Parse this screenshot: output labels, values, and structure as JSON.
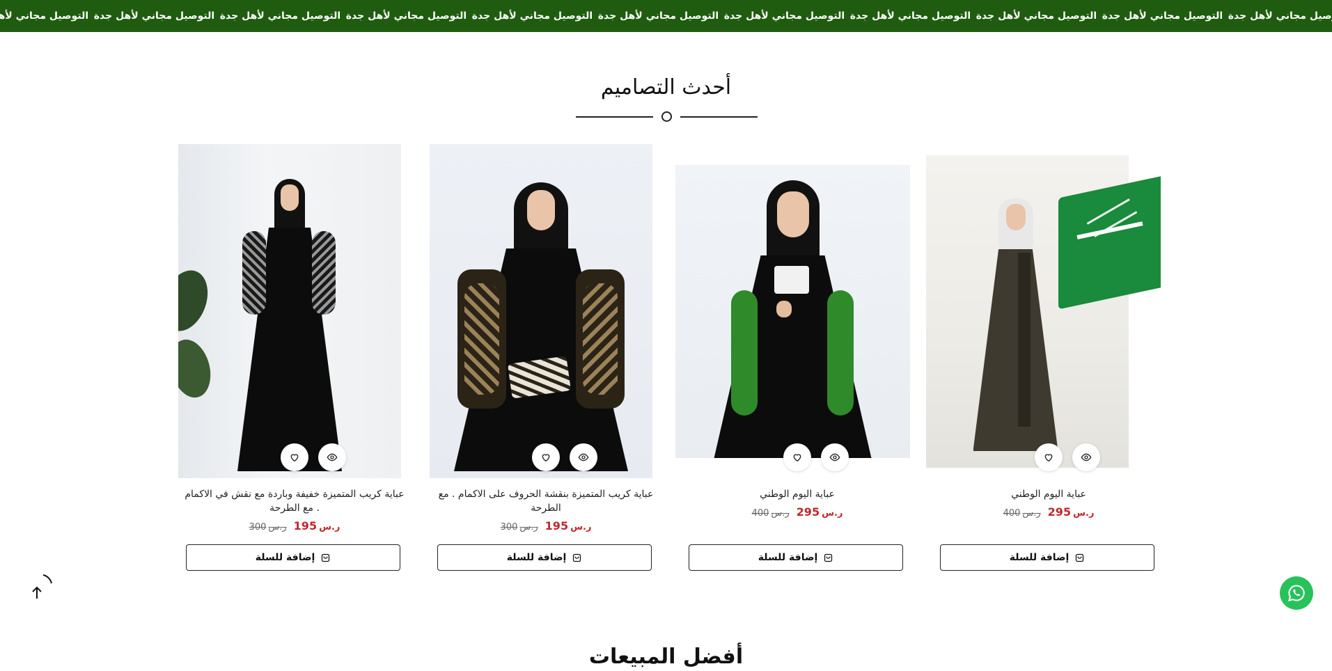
{
  "marquee": {
    "text": "التوصيل مجاني لأهل جدة",
    "items": [
      "التوصيل مجاني لأهل جدة",
      "التوصيل مجاني لأهل جدة",
      "التوصيل مجاني لأهل جدة",
      "التوصيل مجاني لأهل جدة",
      "التوصيل مجاني لأهل جدة",
      "التوصيل مجاني لأهل جدة",
      "التوصيل مجاني لأهل جدة",
      "التوصيل مجاني لأهل جدة",
      "التوصيل مجاني لأهل جدة",
      "التوصيل مجاني لأهل جدة",
      "التوصيل مجاني لأهل جدة",
      "التوصيل مجاني لأهل جدة"
    ]
  },
  "section": {
    "title": "أحدث التصاميم"
  },
  "products": [
    {
      "name": "عباية اليوم الوطني",
      "price": "295",
      "old_price": "400",
      "currency_icon": "saudi-riyal-icon",
      "add_to_cart": "إضافة للسلة",
      "wishlist_icon": "heart-icon",
      "quick_view_icon": "eye-icon"
    },
    {
      "name": "عباية اليوم الوطني",
      "price": "295",
      "old_price": "400",
      "currency_icon": "saudi-riyal-icon",
      "add_to_cart": "إضافة للسلة",
      "wishlist_icon": "heart-icon",
      "quick_view_icon": "eye-icon"
    },
    {
      "name": "عباية كريب المتميزة بنقشة الحروف على الاكمام . مع الطرحة",
      "price": "195",
      "old_price": "300",
      "currency_icon": "saudi-riyal-icon",
      "add_to_cart": "إضافة للسلة",
      "wishlist_icon": "heart-icon",
      "quick_view_icon": "eye-icon"
    },
    {
      "name": "عباية كريب المتميزة خفيفة وباردة مع نقش في الاكمام . مع الطرحة",
      "price": "195",
      "old_price": "300",
      "currency_icon": "saudi-riyal-icon",
      "add_to_cart": "إضافة للسلة",
      "wishlist_icon": "heart-icon",
      "quick_view_icon": "eye-icon"
    }
  ],
  "currency_symbol": "ر.س",
  "next_section": {
    "title": "أفضل المبيعات"
  },
  "colors": {
    "marquee_bg": "#1f5c0f",
    "price_red": "#c0272d",
    "whatsapp_green": "#28c25a",
    "flag_green": "#1a8a3c"
  },
  "floaters": {
    "scroll_top_icon": "arrow-up-icon",
    "whatsapp_icon": "whatsapp-icon"
  }
}
